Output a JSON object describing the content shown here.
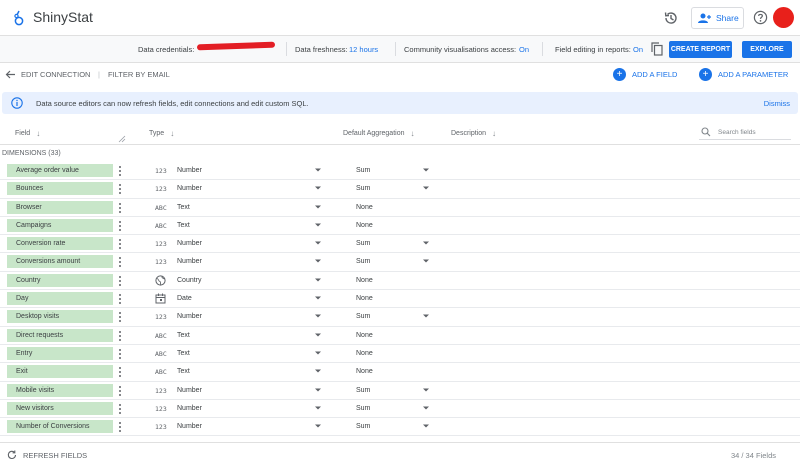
{
  "app": {
    "title": "ShinyStat",
    "share_label": "Share"
  },
  "subbar": {
    "credentials_label": "Data credentials:",
    "freshness_label": "Data freshness:",
    "freshness_value": "12 hours",
    "community_label": "Community visualisations access:",
    "community_value": "On",
    "editing_label": "Field editing in reports:",
    "editing_value": "On",
    "create_report": "CREATE REPORT",
    "explore": "EXPLORE"
  },
  "toolbar": {
    "edit_connection": "EDIT CONNECTION",
    "divider": "|",
    "filter_by_email": "FILTER BY EMAIL",
    "add_field": "ADD A FIELD",
    "add_parameter": "ADD A PARAMETER"
  },
  "banner": {
    "text": "Data source editors can now refresh fields, edit connections and edit custom SQL.",
    "dismiss": "Dismiss"
  },
  "columns": {
    "field": "Field",
    "type": "Type",
    "aggregation": "Default Aggregation",
    "description": "Description",
    "search_placeholder": "Search fields"
  },
  "dimensions_label": "DIMENSIONS (33)",
  "rows": [
    {
      "name": "Average order value",
      "type_icon": "123",
      "type": "Number",
      "aggregation": "Sum",
      "agg_dropdown": true
    },
    {
      "name": "Bounces",
      "type_icon": "123",
      "type": "Number",
      "aggregation": "Sum",
      "agg_dropdown": true
    },
    {
      "name": "Browser",
      "type_icon": "ABC",
      "type": "Text",
      "aggregation": "None",
      "agg_dropdown": false
    },
    {
      "name": "Campaigns",
      "type_icon": "ABC",
      "type": "Text",
      "aggregation": "None",
      "agg_dropdown": false
    },
    {
      "name": "Conversion rate",
      "type_icon": "123",
      "type": "Number",
      "aggregation": "Sum",
      "agg_dropdown": true
    },
    {
      "name": "Conversions amount",
      "type_icon": "123",
      "type": "Number",
      "aggregation": "Sum",
      "agg_dropdown": true
    },
    {
      "name": "Country",
      "type_icon": "globe",
      "type": "Country",
      "aggregation": "None",
      "agg_dropdown": false
    },
    {
      "name": "Day",
      "type_icon": "calendar",
      "type": "Date",
      "aggregation": "None",
      "agg_dropdown": false
    },
    {
      "name": "Desktop visits",
      "type_icon": "123",
      "type": "Number",
      "aggregation": "Sum",
      "agg_dropdown": true
    },
    {
      "name": "Direct requests",
      "type_icon": "ABC",
      "type": "Text",
      "aggregation": "None",
      "agg_dropdown": false
    },
    {
      "name": "Entry",
      "type_icon": "ABC",
      "type": "Text",
      "aggregation": "None",
      "agg_dropdown": false
    },
    {
      "name": "Exit",
      "type_icon": "ABC",
      "type": "Text",
      "aggregation": "None",
      "agg_dropdown": false
    },
    {
      "name": "Mobile visits",
      "type_icon": "123",
      "type": "Number",
      "aggregation": "Sum",
      "agg_dropdown": true
    },
    {
      "name": "New visitors",
      "type_icon": "123",
      "type": "Number",
      "aggregation": "Sum",
      "agg_dropdown": true
    },
    {
      "name": "Number of Conversions",
      "type_icon": "123",
      "type": "Number",
      "aggregation": "Sum",
      "agg_dropdown": true
    }
  ],
  "footer": {
    "refresh": "REFRESH FIELDS",
    "count": "34 / 34 Fields"
  },
  "colors": {
    "accent": "#1a73e8",
    "chip": "#c8e6c9",
    "avatar": "#e8201b",
    "banner": "#e8f0fe"
  }
}
